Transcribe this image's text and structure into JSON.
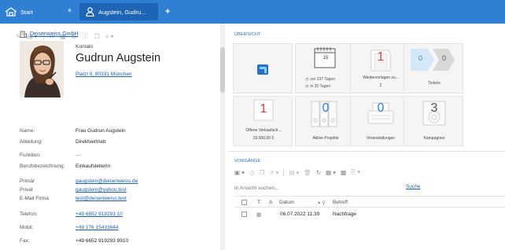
{
  "tabs": {
    "start_label": "Start",
    "contact_label": "Augstein, Gudru...",
    "add_label": "+"
  },
  "contact": {
    "company": "Deisenweiss GmbH",
    "type": "Kontakt",
    "name": "Gudrun Augstein",
    "address": "Platzl 9, 80331 München"
  },
  "fields": [
    {
      "label": "Name:",
      "value": "Frau Gudrun Augstein"
    },
    {
      "label": "Abteilung:",
      "value": "Direktvertrieb"
    },
    {
      "label": "Funktion:",
      "value": "—"
    },
    {
      "label": "Berufsbezeichnung:",
      "value": "Einkaufsleiterin"
    },
    {
      "label": "Primär",
      "value": "gaugstein@deisenweiss.de"
    },
    {
      "label": "Privat",
      "value": "gaugstein@yahoo.test"
    },
    {
      "label": "E-Mail Firma",
      "value": "test@deisenweiss.test"
    },
    {
      "label": "Telefon:",
      "value": "+49 6652 919293 10"
    },
    {
      "label": "Mobil:",
      "value": "+49 176 15433644"
    },
    {
      "label": "Fax:",
      "value": "+49 6652 919293 9910"
    }
  ],
  "overview": {
    "section_label": "ÜBERSICHT",
    "calendar_day": "15",
    "calendar_line1": "vor 237 Tagen",
    "calendar_line2": "in 35 Tagen",
    "wiedervorlagen_count": "1",
    "wiedervorlagen_label": "Wiedervorlagen zu...",
    "wiedervorlagen_sub": "2",
    "tickets_a": "0",
    "tickets_b": "0",
    "tickets_label": "Tickets",
    "offene_count": "1",
    "offene_label": "Offene Verkaufsch...",
    "offene_value": "29.500,00 €",
    "projekte_count": "0",
    "projekte_label": "Aktive Projekte",
    "veranstaltungen_count": "0",
    "veranstaltungen_label": "Veranstaltungen",
    "kampagnen_count": "3",
    "kampagnen_label": "Kampagnen"
  },
  "vorgaenge": {
    "section_label": "VORGÄNGE",
    "search_placeholder": "In Ansicht suchen...",
    "search_link": "Suche",
    "columns": [
      "T:",
      "A",
      "Datum",
      "Betreff"
    ],
    "rows": [
      {
        "date": "06.07.2022 11:39",
        "subject": "Nachfrage"
      }
    ]
  },
  "colors": {
    "topbar": "#2f7fd4",
    "active_tab": "#1f65b6",
    "link": "#1f5fb5",
    "red": "#e04040",
    "blue": "#2f7fd4"
  }
}
